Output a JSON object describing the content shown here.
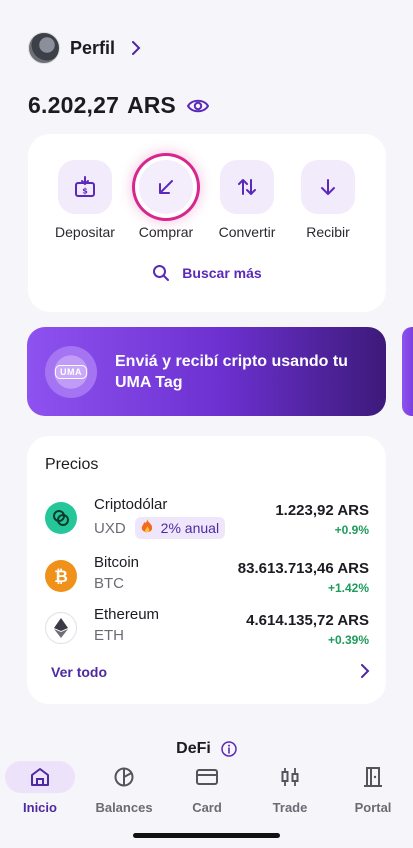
{
  "header": {
    "profile_label": "Perfil",
    "balance_amount": "6.202,27",
    "balance_currency": "ARS"
  },
  "actions": [
    {
      "label": "Depositar",
      "icon": "deposit-icon"
    },
    {
      "label": "Comprar",
      "icon": "arrow-down-left-icon"
    },
    {
      "label": "Convertir",
      "icon": "swap-vertical-icon"
    },
    {
      "label": "Recibir",
      "icon": "arrow-down-icon"
    }
  ],
  "search_more": "Buscar más",
  "banner": {
    "badge": "UMA",
    "text": "Enviá y recibí cripto usando tu UMA Tag"
  },
  "prices": {
    "title": "Precios",
    "items": [
      {
        "name": "Criptodólar",
        "ticker": "UXD",
        "badge": "2% anual",
        "price": "1.223,92 ARS",
        "change": "+0.9%",
        "color": "#25c79a"
      },
      {
        "name": "Bitcoin",
        "ticker": "BTC",
        "price": "83.613.713,46 ARS",
        "change": "+1.42%",
        "color": "#f0911a"
      },
      {
        "name": "Ethereum",
        "ticker": "ETH",
        "price": "4.614.135,72 ARS",
        "change": "+0.39%",
        "color": "#ffffff"
      }
    ],
    "see_all": "Ver todo"
  },
  "defi_title": "DeFi",
  "nav": [
    {
      "label": "Inicio",
      "icon": "home-icon",
      "active": true
    },
    {
      "label": "Balances",
      "icon": "pie-chart-icon"
    },
    {
      "label": "Card",
      "icon": "card-icon"
    },
    {
      "label": "Trade",
      "icon": "candlestick-icon"
    },
    {
      "label": "Portal",
      "icon": "door-icon"
    }
  ],
  "colors": {
    "accent": "#5b2ab8",
    "highlight_ring": "#d7268e",
    "positive": "#1e9c5c",
    "banner_start": "#8e52f0",
    "banner_end": "#3d1a7a"
  }
}
